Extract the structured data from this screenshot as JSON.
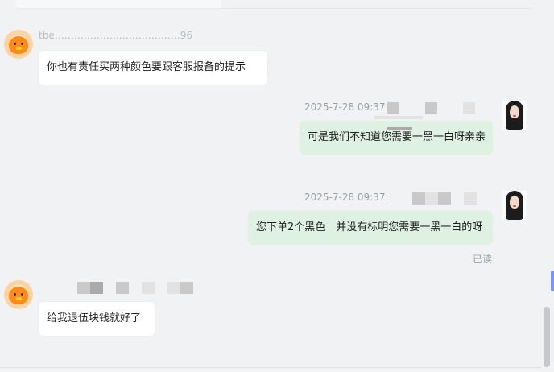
{
  "messages": [
    {
      "side": "incoming",
      "sender_meta_partial": "tbe…………………………………96",
      "text": "你也有责任买两种颜色要跟客服报备的提示"
    },
    {
      "side": "outgoing",
      "timestamp": "2025-7-28 09:37",
      "text": "可是我们不知道您需要一黑一白呀亲亲"
    },
    {
      "side": "outgoing",
      "timestamp": "2025-7-28 09:37:",
      "text": "您下单2个黑色　并没有标明您需要一黑一白的呀",
      "status": "已读"
    },
    {
      "side": "incoming",
      "text": "给我退伍块钱就好了"
    }
  ],
  "colors": {
    "background": "#f1f2f4",
    "incoming_bubble": "#ffffff",
    "outgoing_bubble": "#dff1e3",
    "meta_text": "#9aa0a6",
    "scroll_thumb": "#c6c8cc",
    "accent_tab": "#7c95f5"
  },
  "icons": {
    "incoming_avatar": "duck-avatar-icon",
    "outgoing_avatar": "girl-avatar-icon"
  }
}
